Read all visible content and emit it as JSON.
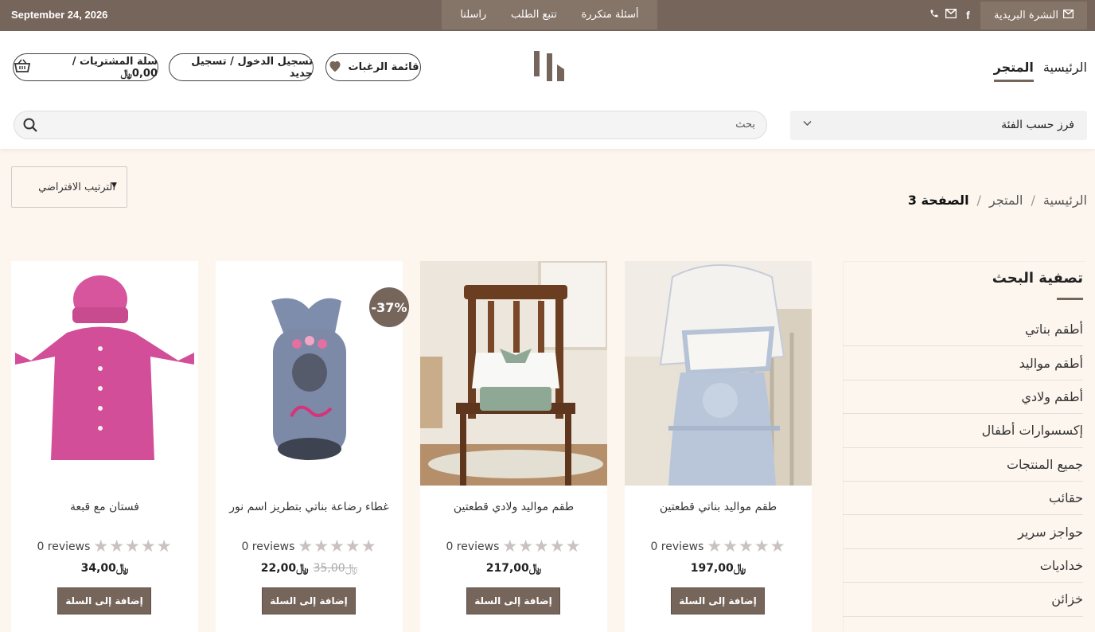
{
  "topbar": {
    "date": "September 24, 2026",
    "nav": [
      "أسئلة متكررة",
      "تتبع الطلب",
      "راسلنا"
    ],
    "newsletter": "النشرة البريدية",
    "social_icons": [
      "facebook-icon",
      "mail-icon",
      "phone-icon"
    ]
  },
  "header": {
    "cart": "سلة المشتريات / ",
    "cart_amount": "0,00",
    "currency": "﷼",
    "login": "تسجيل الدخول / تسجيل جديد",
    "wishlist": "قائمة الرغبات",
    "nav": [
      "الرئيسية",
      "المتجر"
    ],
    "nav_active": "المتجر",
    "search_placeholder": "بحث",
    "category_select": "فرز حسب الفئة"
  },
  "sort": {
    "selected": "الترتيب الافتراضي"
  },
  "breadcrumb": {
    "home": "الرئيسية",
    "sep": "/",
    "shop": "المتجر",
    "current": "الصفحة 3"
  },
  "sidebar": {
    "title": "تصفية البحث",
    "categories": [
      "أطقم بناتي",
      "أطقم مواليد",
      "أطقم ولادي",
      "إكسسوارات أطفال",
      "جميع المنتجات",
      "حقائب",
      "حواجز سرير",
      "خداديات",
      "خزائن"
    ]
  },
  "products": [
    {
      "name": "طقم مواليد بناتي قطعتين",
      "reviews": "0 reviews",
      "price": "197,00",
      "old_price": "",
      "button": "إضافة إلى السلة",
      "rating": 0
    },
    {
      "name": "طقم مواليد ولادي قطعتين",
      "reviews": "0 reviews",
      "price": "217,00",
      "old_price": "",
      "button": "إضافة إلى السلة",
      "rating": 0
    },
    {
      "name": "غطاء رضاعة بناتي بتطريز اسم نور",
      "reviews": "0 reviews",
      "price": "22,00",
      "old_price": "35,00",
      "badge": "-37%",
      "button": "إضافة إلى السلة",
      "rating": 0
    },
    {
      "name": "فستان مع قبعة",
      "reviews": "0 reviews",
      "price": "34,00",
      "old_price": "",
      "button": "إضافة إلى السلة",
      "rating": 0
    }
  ],
  "colors": {
    "brand": "#76655b",
    "bg": "#fdf6ee"
  }
}
